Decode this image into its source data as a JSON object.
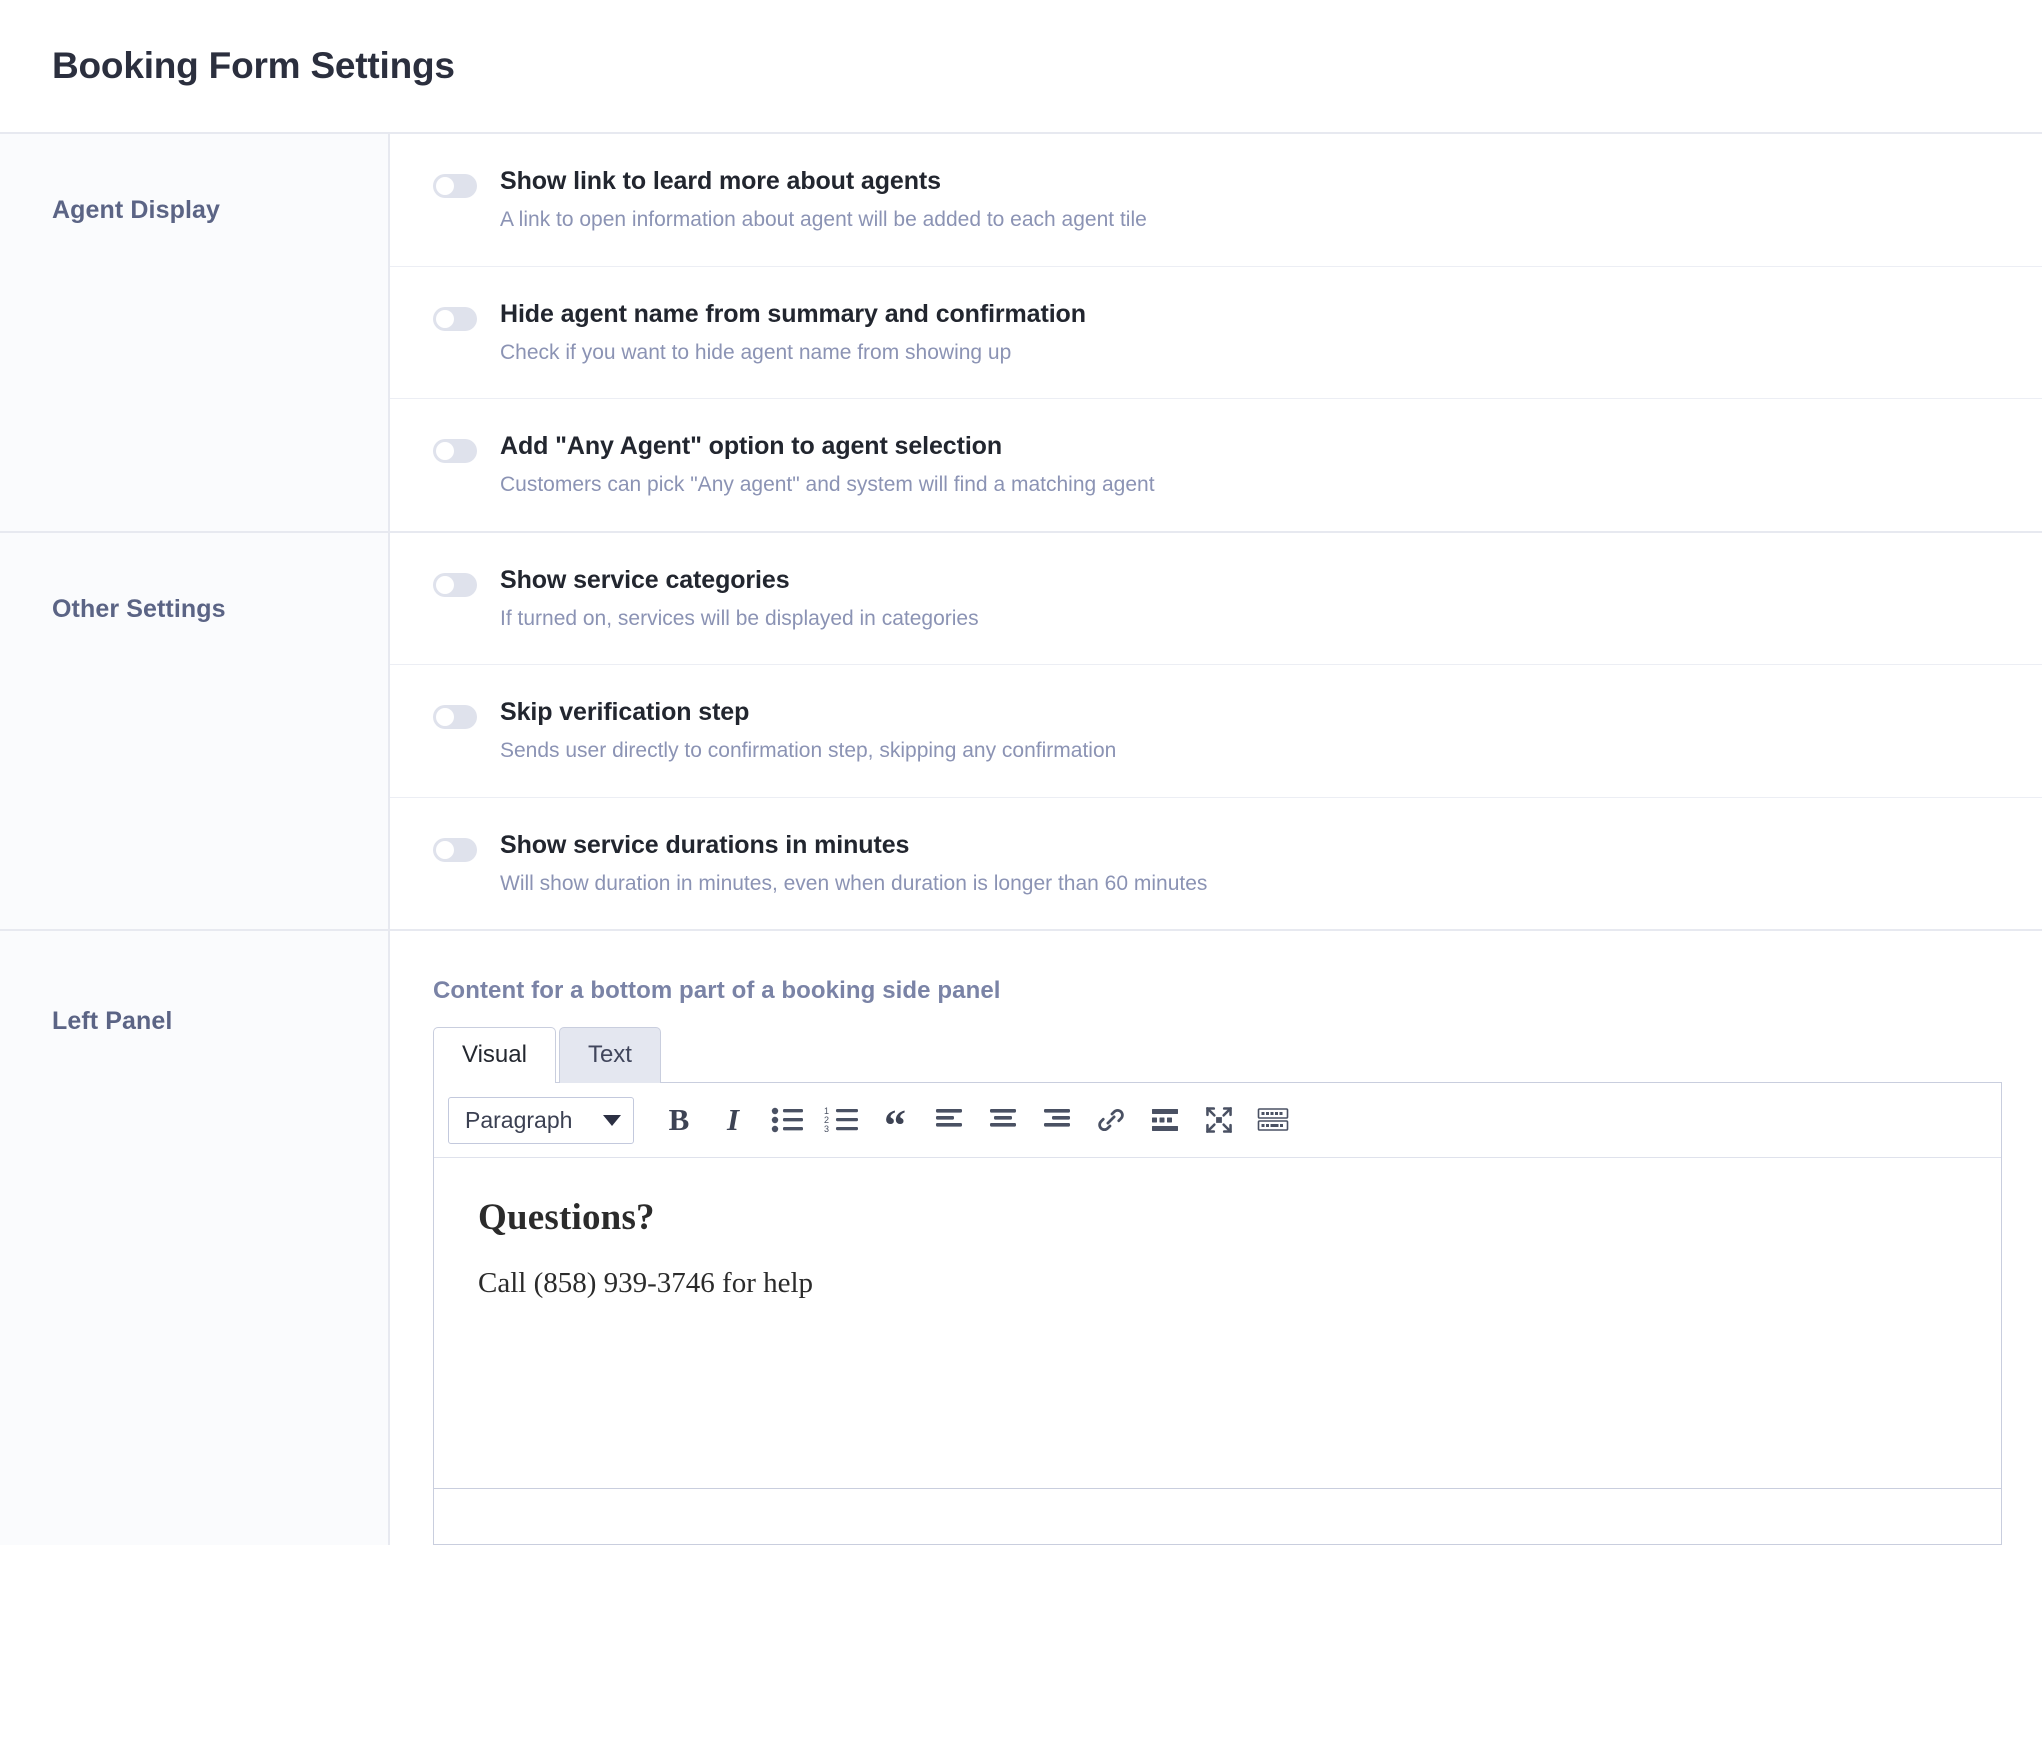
{
  "header": {
    "title": "Booking Form Settings"
  },
  "sections": [
    {
      "id": "agent-display",
      "label": "Agent Display",
      "rows": [
        {
          "label": "Show link to leard more about agents",
          "desc": "A link to open information about agent will be added to each agent tile",
          "state": "off"
        },
        {
          "label": "Hide agent name from summary and confirmation",
          "desc": "Check if you want to hide agent name from showing up",
          "state": "off"
        },
        {
          "label": "Add \"Any Agent\" option to agent selection",
          "desc": "Customers can pick \"Any agent\" and system will find a matching agent",
          "state": "off"
        }
      ]
    },
    {
      "id": "other-settings",
      "label": "Other Settings",
      "rows": [
        {
          "label": "Show service categories",
          "desc": "If turned on, services will be displayed in categories",
          "state": "off"
        },
        {
          "label": "Skip verification step",
          "desc": "Sends user directly to confirmation step, skipping any confirmation",
          "state": "off"
        },
        {
          "label": "Show service durations in minutes",
          "desc": "Will show duration in minutes, even when duration is longer than 60 minutes",
          "state": "off"
        }
      ]
    }
  ],
  "left_panel": {
    "label": "Left Panel",
    "caption": "Content for a bottom part of a booking side panel",
    "tabs": [
      {
        "label": "Visual",
        "active": true
      },
      {
        "label": "Text",
        "active": false
      }
    ],
    "toolbar": {
      "format_select_value": "Paragraph",
      "buttons": [
        {
          "name": "bold-icon",
          "label": "B"
        },
        {
          "name": "italic-icon",
          "label": "I"
        },
        {
          "name": "bulleted-list-icon",
          "label": "Bulleted list"
        },
        {
          "name": "numbered-list-icon",
          "label": "Numbered list"
        },
        {
          "name": "blockquote-icon",
          "label": "Blockquote"
        },
        {
          "name": "align-left-icon",
          "label": "Align left"
        },
        {
          "name": "align-center-icon",
          "label": "Align center"
        },
        {
          "name": "align-right-icon",
          "label": "Align right"
        },
        {
          "name": "link-icon",
          "label": "Insert link"
        },
        {
          "name": "read-more-icon",
          "label": "Insert Read More tag"
        },
        {
          "name": "fullscreen-icon",
          "label": "Fullscreen"
        },
        {
          "name": "keyboard-shortcuts-icon",
          "label": "Keyboard shortcuts"
        }
      ]
    },
    "content": {
      "heading": "Questions?",
      "paragraph": "Call (858) 939-3746 for help"
    }
  },
  "colors": {
    "accent": "#4f6ef7",
    "toggle_off_track": "#dfe2ec",
    "muted_text": "#8b93b4",
    "aside_label": "#5b6485",
    "border": "#e7e9f0"
  }
}
